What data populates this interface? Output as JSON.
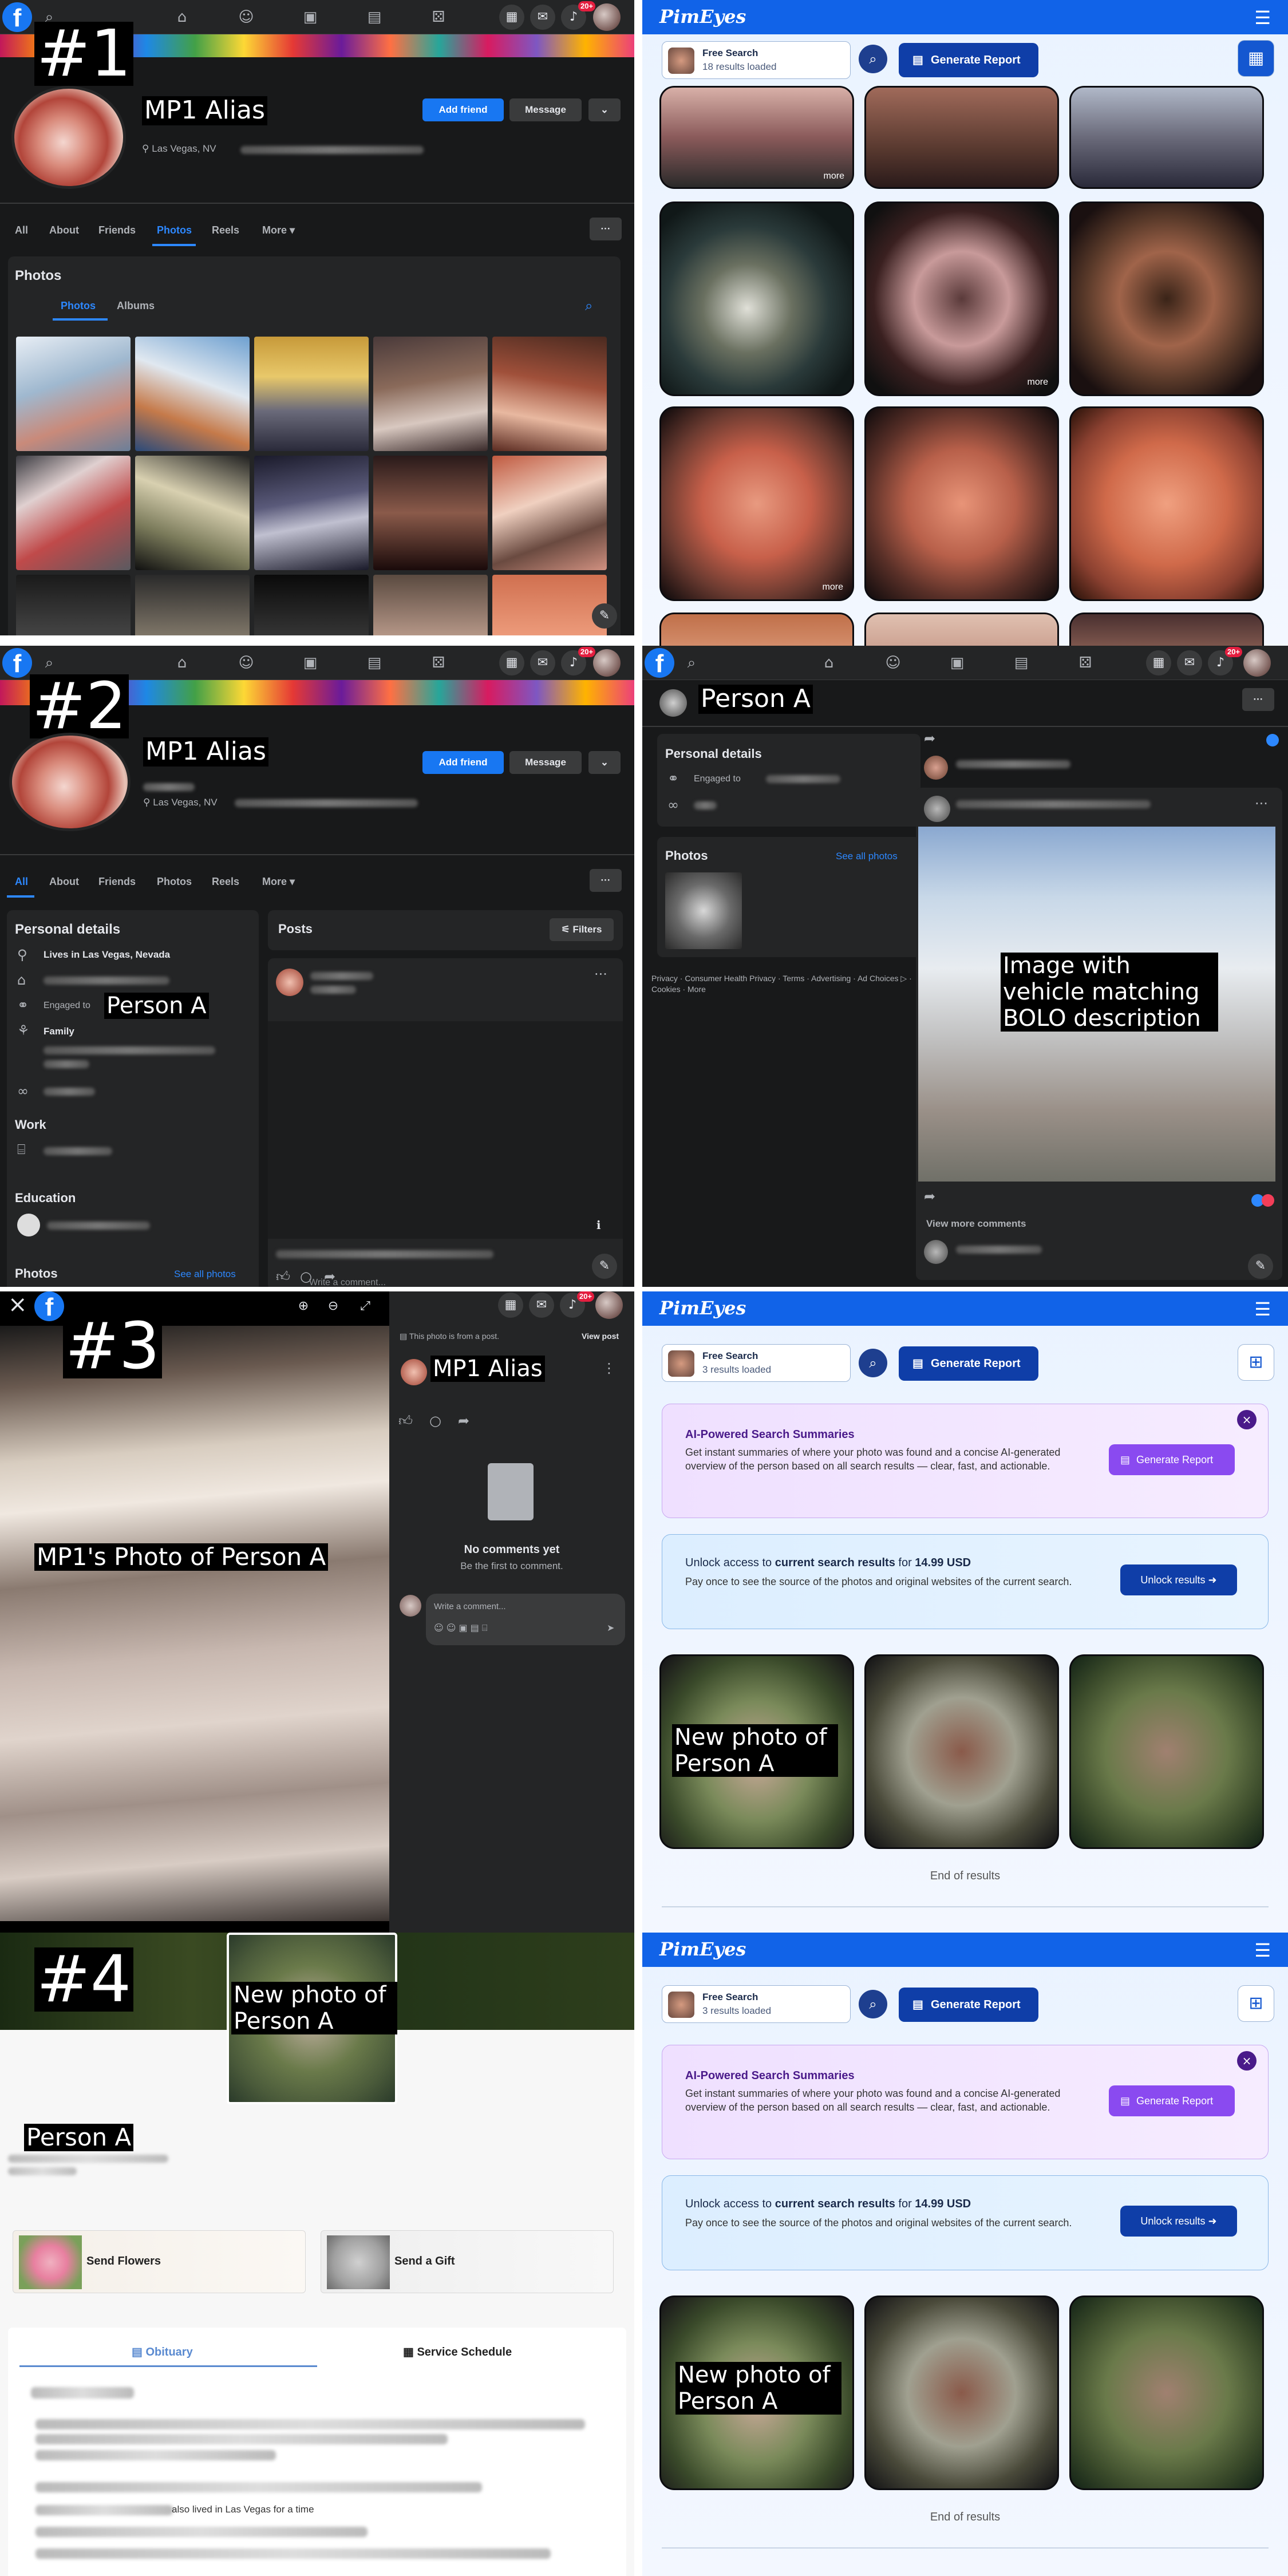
{
  "labels": {
    "p1": "#1",
    "p2": "#2",
    "p3": "#3",
    "p4": "#4",
    "mp1_alias": "MP1 Alias",
    "person_a": "Person A",
    "vehicle_image": "Image with vehicle matching BOLO description",
    "mp1_photo": "MP1's Photo of Person A",
    "new_photo": "New photo of Person A"
  },
  "facebook": {
    "logo": "f",
    "notifications": "20+",
    "profile_name": "MP1 Alias",
    "location": "Las Vegas, NV",
    "add_friend": "Add friend",
    "message": "Message",
    "more_dots": "···",
    "tabs": [
      "All",
      "About",
      "Friends",
      "Photos",
      "Reels",
      "More ▾"
    ],
    "photos_heading": "Photos",
    "photos_subtabs": [
      "Photos",
      "Albums"
    ],
    "personal_details": "Personal details",
    "lives_in": "Lives in Las Vegas, Nevada",
    "engaged_to": "Engaged to",
    "family": "Family",
    "work": "Work",
    "education": "Education",
    "photos": "Photos",
    "see_all_photos": "See all photos",
    "posts": "Posts",
    "filters": "Filters",
    "write_comment": "Write a comment...",
    "footer_links": "Privacy · Consumer Health Privacy · Terms · Advertising · Ad Choices ▷ · Cookies · More",
    "view_more_comments": "View more comments",
    "photo_from_post": "This photo is from a post.",
    "view_post": "View post",
    "no_comments": "No comments yet",
    "be_first": "Be the first to comment."
  },
  "pimeyes": {
    "logo": "PimEyes",
    "search_title": "Free Search",
    "results_18": "18 results loaded",
    "results_3": "3 results loaded",
    "generate_report": "Generate Report",
    "ai_title": "AI-Powered Search Summaries",
    "ai_body": "Get instant summaries of where your photo was found and a concise AI-generated overview of the person based on all search results — clear, fast, and actionable.",
    "unlock_prefix": "Unlock access to ",
    "unlock_bold": "current search results",
    "unlock_mid": " for ",
    "unlock_price": "14.99 USD",
    "unlock_body": "Pay once to see the source of the photos and original websites of the current search.",
    "unlock_button": "Unlock results",
    "end_of_results": "End of results",
    "more": "more"
  },
  "obituary": {
    "send_flowers": "Send Flowers",
    "send_gift": "Send a Gift",
    "tab_obituary": "Obituary",
    "tab_schedule": "Service Schedule",
    "lived_text": "also lived in Las Vegas for a time"
  }
}
